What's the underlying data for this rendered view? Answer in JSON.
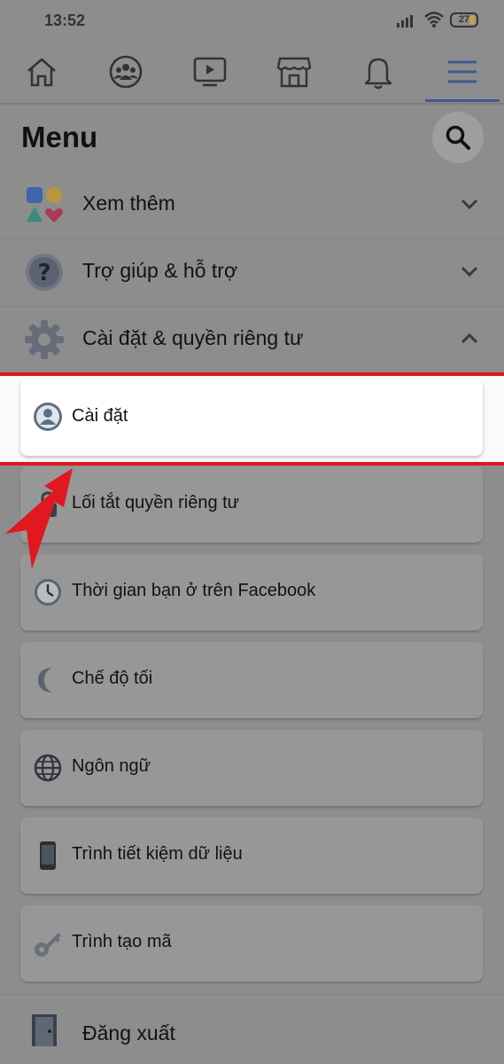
{
  "status_bar": {
    "time": "13:52",
    "battery": "27"
  },
  "nav": {
    "items": [
      "home-icon",
      "groups-icon",
      "watch-icon",
      "marketplace-icon",
      "notifications-icon",
      "menu-icon"
    ],
    "active": "menu-icon"
  },
  "header": {
    "title": "Menu"
  },
  "sections": [
    {
      "label": "Xem thêm",
      "icon": "shortcuts-icon",
      "state": "collapsed"
    },
    {
      "label": "Trợ giúp & hỗ trợ",
      "icon": "help-icon",
      "state": "collapsed"
    },
    {
      "label": "Cài đặt & quyền riêng tư",
      "icon": "gear-icon",
      "state": "expanded"
    }
  ],
  "settings_items": [
    {
      "label": "Cài đặt",
      "icon": "person-icon",
      "highlighted": true
    },
    {
      "label": "Lối tắt quyền riêng tư",
      "icon": "lock-icon"
    },
    {
      "label": "Thời gian bạn ở trên Facebook",
      "icon": "clock-icon"
    },
    {
      "label": "Chế độ tối",
      "icon": "moon-icon"
    },
    {
      "label": "Ngôn ngữ",
      "icon": "globe-icon"
    },
    {
      "label": "Trình tiết kiệm dữ liệu",
      "icon": "phone-icon"
    },
    {
      "label": "Trình tạo mã",
      "icon": "key-icon"
    }
  ],
  "logout": {
    "label": "Đăng xuất",
    "icon": "door-icon"
  },
  "colors": {
    "highlight_border": "#e0181f",
    "accent": "#3e5a8f"
  }
}
